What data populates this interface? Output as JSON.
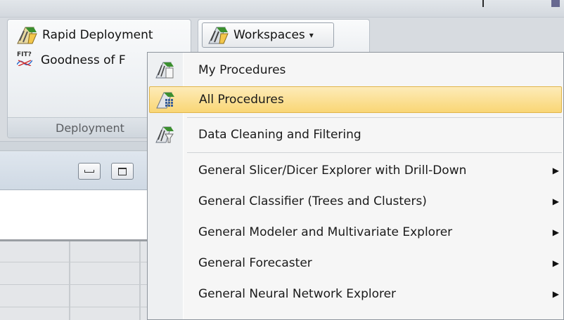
{
  "ribbon": {
    "rapid_deployment_label": "Rapid Deployment",
    "goodness_label": "Goodness of F",
    "fit_icon_text": "FIT?",
    "deployment_group_label": "Deployment",
    "workspaces_label": "Workspaces",
    "dropdown_caret": "▾"
  },
  "menu": {
    "items": [
      {
        "label": "My Procedures",
        "icon": "procedures-icon",
        "submenu": false
      },
      {
        "label": "All Procedures",
        "icon": "procedures-grid-icon",
        "submenu": false,
        "highlighted": true
      },
      {
        "label": "Data Cleaning and Filtering",
        "icon": "data-cleaning-icon",
        "submenu": false
      },
      {
        "label": "General Slicer/Dicer Explorer with Drill-Down",
        "submenu": true
      },
      {
        "label": "General Classifier (Trees and Clusters)",
        "submenu": true
      },
      {
        "label": "General Modeler and Multivariate Explorer",
        "submenu": true
      },
      {
        "label": "General Forecaster",
        "submenu": true
      },
      {
        "label": "General Neural Network Explorer",
        "submenu": true
      }
    ],
    "submenu_arrow": "▶"
  },
  "colors": {
    "highlight": "#f9d675",
    "highlight_border": "#e0b54b",
    "menu_bg": "#f6f6f6"
  }
}
